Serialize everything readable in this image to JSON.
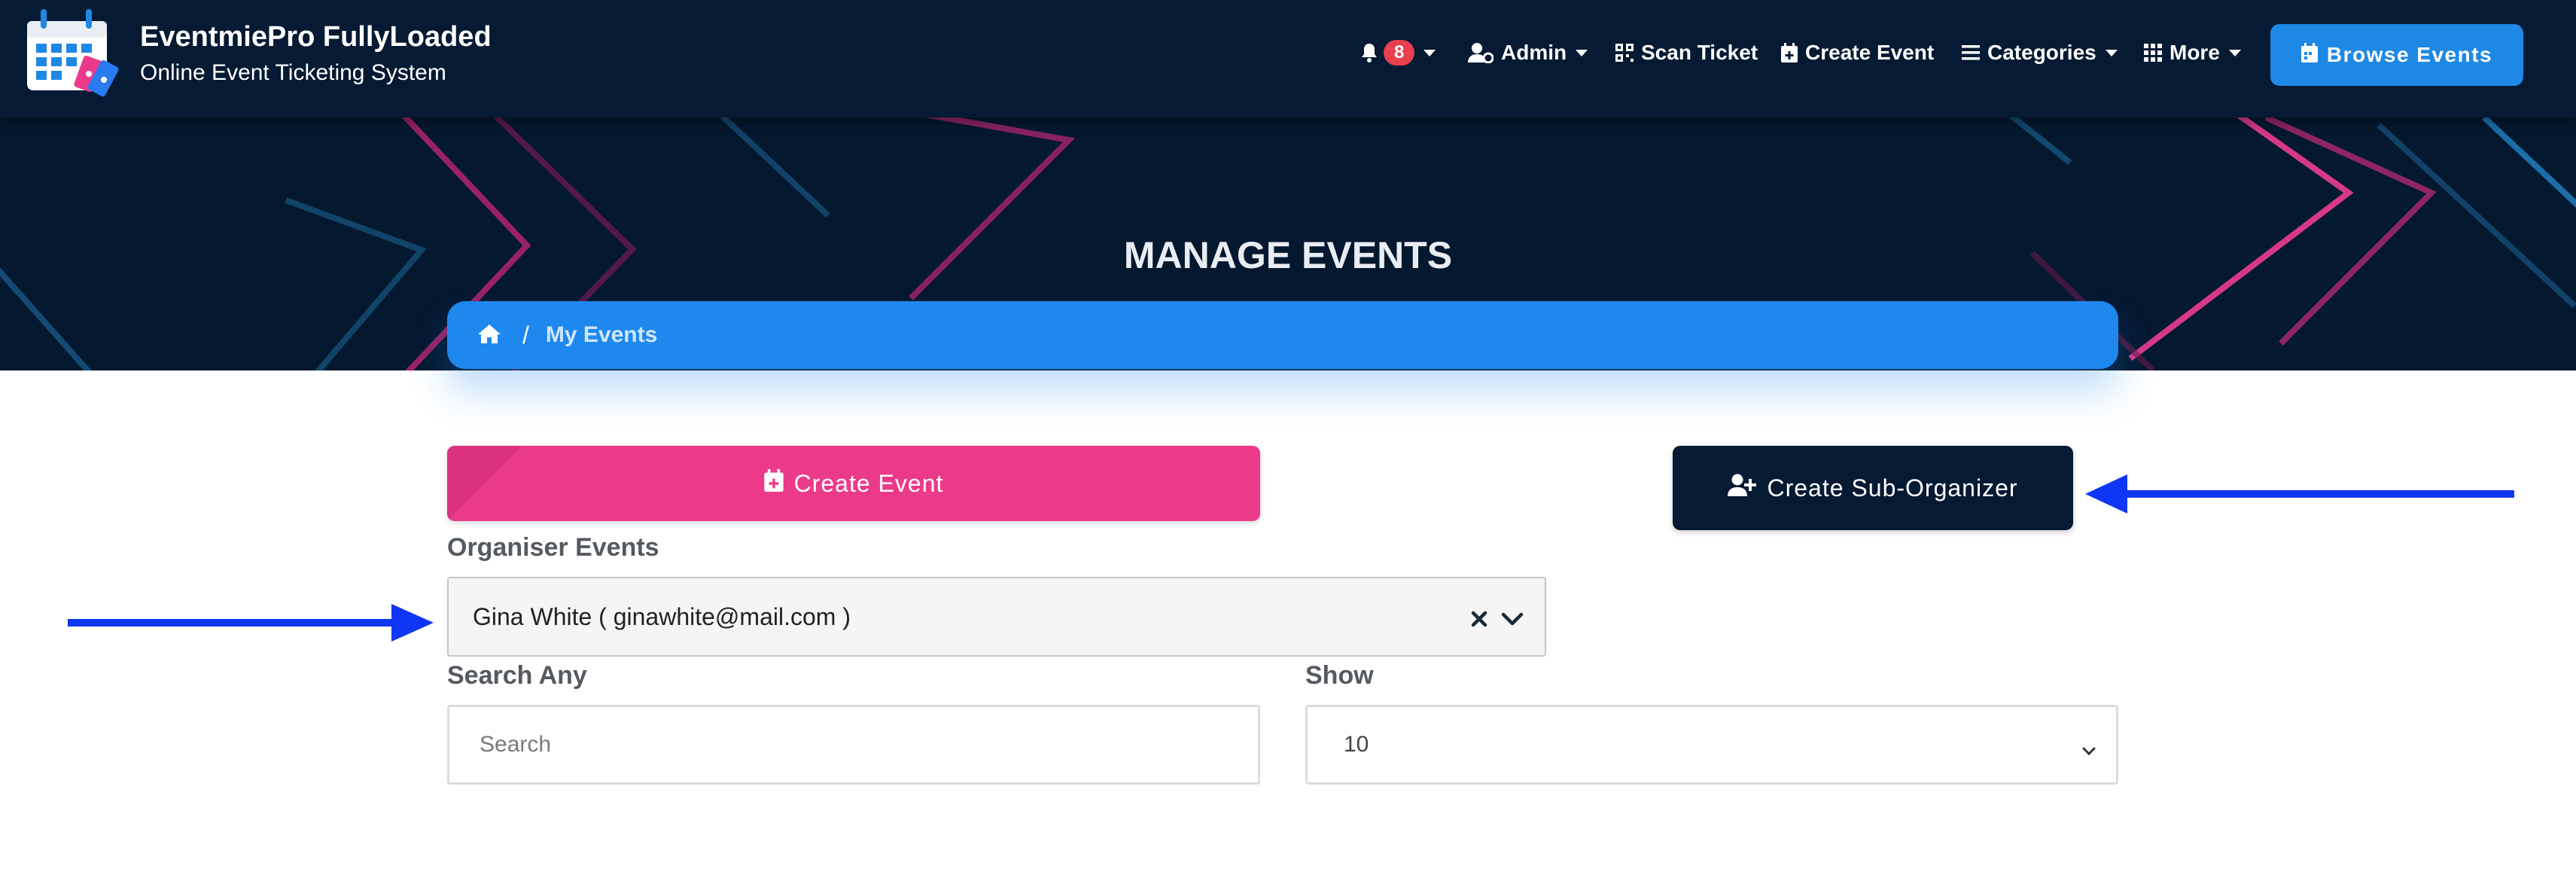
{
  "brand": {
    "title": "EventmiePro FullyLoaded",
    "subtitle": "Online Event Ticketing System"
  },
  "nav": {
    "notifications_count": "8",
    "admin_label": "Admin",
    "scan_ticket_label": "Scan Ticket",
    "create_event_label": "Create Event",
    "categories_label": "Categories",
    "more_label": "More",
    "browse_events_label": "Browse Events"
  },
  "hero": {
    "title": "MANAGE EVENTS"
  },
  "breadcrumb": {
    "current": "My Events"
  },
  "actions": {
    "create_event_label": "Create Event",
    "create_sub_organizer_label": "Create Sub-Organizer"
  },
  "filters": {
    "organiser_label": "Organiser Events",
    "organiser_value": "Gina White ( ginawhite@mail.com )",
    "search_label": "Search Any",
    "search_placeholder": "Search",
    "show_label": "Show",
    "show_value": "10"
  },
  "colors": {
    "navbar": "#061a33",
    "accent_blue": "#1e88e5",
    "pink": "#ec3a8a",
    "badge": "#e8404f",
    "annotation_arrow": "#1036f5"
  },
  "icons": [
    "calendar-tickets-logo",
    "bell-icon",
    "user-gear-icon",
    "qrcode-icon",
    "calendar-plus-icon",
    "bars-icon",
    "grid-icon",
    "home-icon",
    "user-plus-icon",
    "clear-x-icon",
    "chevron-down-icon"
  ]
}
